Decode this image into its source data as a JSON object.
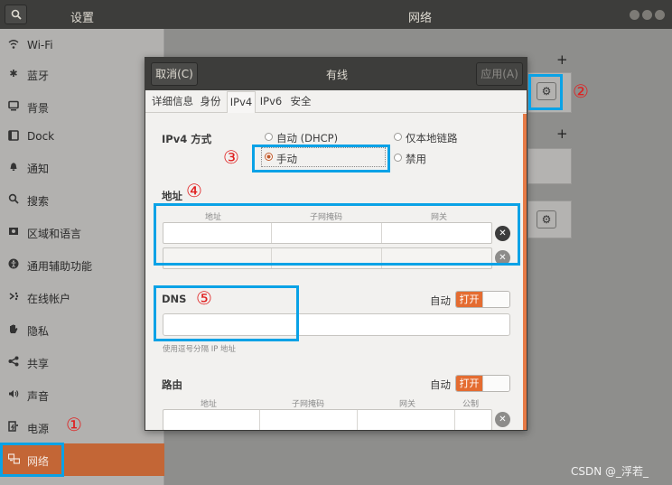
{
  "header": {
    "left_title": "设置",
    "right_title": "网络",
    "icons": [
      "search-icon",
      "minimize-icon",
      "maximize-icon",
      "close-icon"
    ]
  },
  "sidebar": {
    "items": [
      {
        "label": "Wi-Fi",
        "icon": "wifi-icon"
      },
      {
        "label": "蓝牙",
        "icon": "bluetooth-icon"
      },
      {
        "label": "背景",
        "icon": "background-icon"
      },
      {
        "label": "Dock",
        "icon": "dock-icon"
      },
      {
        "label": "通知",
        "icon": "bell-icon"
      },
      {
        "label": "搜索",
        "icon": "search-icon"
      },
      {
        "label": "区域和语言",
        "icon": "flag-icon"
      },
      {
        "label": "通用辅助功能",
        "icon": "accessibility-icon"
      },
      {
        "label": "在线帐户",
        "icon": "online-accounts-icon"
      },
      {
        "label": "隐私",
        "icon": "hand-icon"
      },
      {
        "label": "共享",
        "icon": "share-icon"
      },
      {
        "label": "声音",
        "icon": "speaker-icon"
      },
      {
        "label": "电源",
        "icon": "power-icon"
      },
      {
        "label": "网络",
        "icon": "network-icon",
        "active": true
      }
    ]
  },
  "background_panel": {
    "plus_symbol": "+",
    "gear_symbol": "⚙"
  },
  "dialog": {
    "title": "有线",
    "cancel_label": "取消(C)",
    "apply_label": "应用(A)",
    "tabs": [
      "详细信息",
      "身份",
      "IPv4",
      "IPv6",
      "安全"
    ],
    "active_tab": "IPv4",
    "ipv4_method": {
      "label": "IPv4 方式",
      "options": [
        "自动 (DHCP)",
        "手动",
        "仅本地链路",
        "禁用"
      ],
      "selected": "手动"
    },
    "address": {
      "label": "地址",
      "columns": [
        "地址",
        "子网掩码",
        "网关"
      ]
    },
    "dns": {
      "label": "DNS",
      "auto_label": "自动",
      "toggle_label": "打开",
      "value": "",
      "hint": "使用逗号分隔 IP 地址"
    },
    "routes": {
      "label": "路由",
      "auto_label": "自动",
      "toggle_label": "打开",
      "columns": [
        "地址",
        "子网掩码",
        "网关",
        "公制"
      ]
    }
  },
  "annotations": {
    "markers": [
      "①",
      "②",
      "③",
      "④",
      "⑤"
    ],
    "highlight_color": "#0aa2e6",
    "marker_color": "#e02020"
  },
  "watermark": "CSDN @_浮若_",
  "colors": {
    "accent": "#c36636",
    "toggle_on": "#e46c31",
    "header_bg": "#3d3d3b"
  }
}
